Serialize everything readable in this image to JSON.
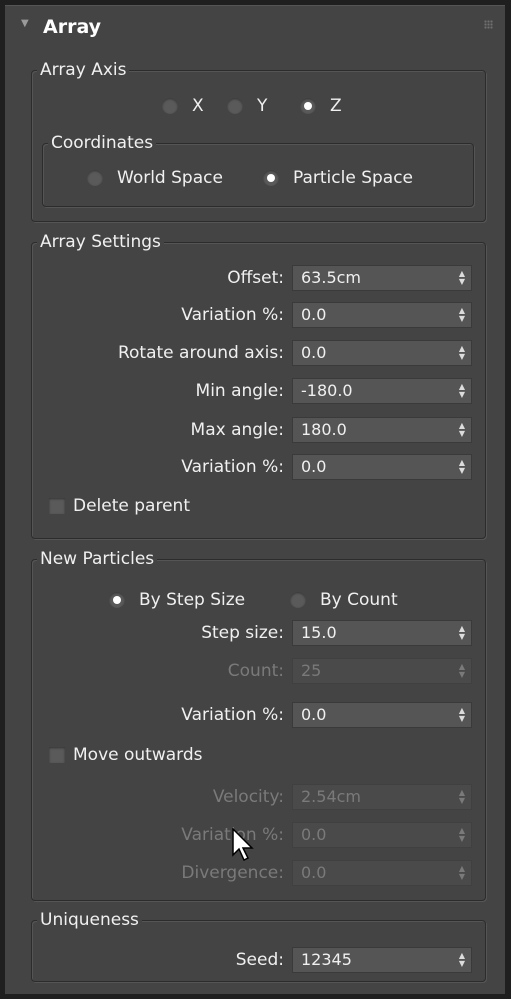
{
  "rollout": {
    "title": "Array",
    "arrow": "▼"
  },
  "array_axis": {
    "label": "Array Axis",
    "options": [
      "X",
      "Y",
      "Z"
    ],
    "selected": "Z",
    "coordinates": {
      "label": "Coordinates",
      "options": [
        "World Space",
        "Particle Space"
      ],
      "selected": "Particle Space"
    }
  },
  "array_settings": {
    "label": "Array Settings",
    "offset_label": "Offset:",
    "offset_value": "63.5cm",
    "variation1_label": "Variation %:",
    "variation1_value": "0.0",
    "rotate_label": "Rotate around axis:",
    "rotate_value": "0.0",
    "min_angle_label": "Min angle:",
    "min_angle_value": "-180.0",
    "max_angle_label": "Max angle:",
    "max_angle_value": "180.0",
    "variation2_label": "Variation %:",
    "variation2_value": "0.0",
    "delete_parent_label": "Delete parent",
    "delete_parent_checked": false
  },
  "new_particles": {
    "label": "New Particles",
    "options": [
      "By Step Size",
      "By Count"
    ],
    "selected": "By Step Size",
    "step_size_label": "Step size:",
    "step_size_value": "15.0",
    "count_label": "Count:",
    "count_value": "25",
    "variation_label": "Variation %:",
    "variation_value": "0.0",
    "move_outwards_label": "Move outwards",
    "move_outwards_checked": false,
    "velocity_label": "Velocity:",
    "velocity_value": "2.54cm",
    "variation2_label": "Variation %:",
    "variation2_value": "0.0",
    "divergence_label": "Divergence:",
    "divergence_value": "0.0"
  },
  "uniqueness": {
    "label": "Uniqueness",
    "seed_label": "Seed:",
    "seed_value": "12345"
  },
  "icons": {
    "spinner": "up-down-arrows-icon",
    "cursor": "mouse-pointer-icon",
    "grip": "grip-dots-icon",
    "collapse": "triangle-down-icon"
  },
  "colors": {
    "panel_bg": "#444444",
    "field_bg": "#555555",
    "text": "#f0f0f0",
    "disabled_text": "#7a7a7a"
  }
}
